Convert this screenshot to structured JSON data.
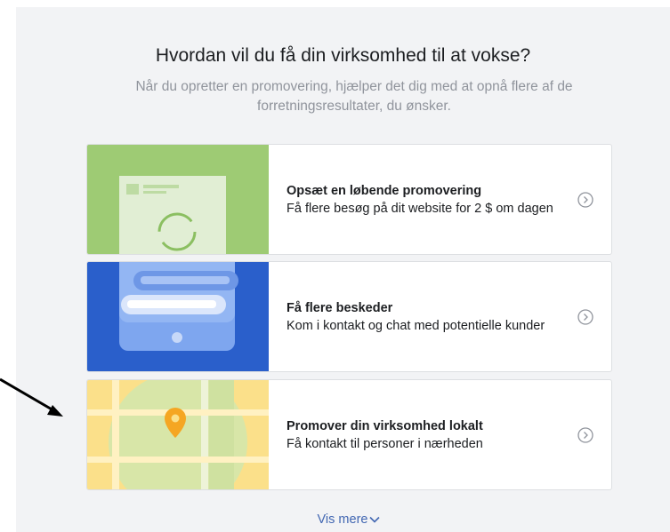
{
  "header": {
    "title": "Hvordan vil du få din virksomhed til at vokse?",
    "subtitle": "Når du opretter en promovering, hjælper det dig med at opnå flere af de forretningsresultater, du ønsker."
  },
  "options": [
    {
      "title": "Opsæt en løbende promovering",
      "description": "Få flere besøg på dit website for 2 $ om dagen",
      "accent": "#9ecb74"
    },
    {
      "title": "Få flere beskeder",
      "description": "Kom i kontakt og chat med potentielle kunder",
      "accent": "#2a5fcb"
    },
    {
      "title": "Promover din virksomhed lokalt",
      "description": "Få kontakt til personer i nærheden",
      "accent": "#fbe08a"
    }
  ],
  "show_more": {
    "label": "Vis mere",
    "icon": "chevron-down-icon"
  },
  "colors": {
    "panel_background": "#f2f3f5",
    "link": "#4267b2",
    "secondary_text": "#90949c"
  }
}
